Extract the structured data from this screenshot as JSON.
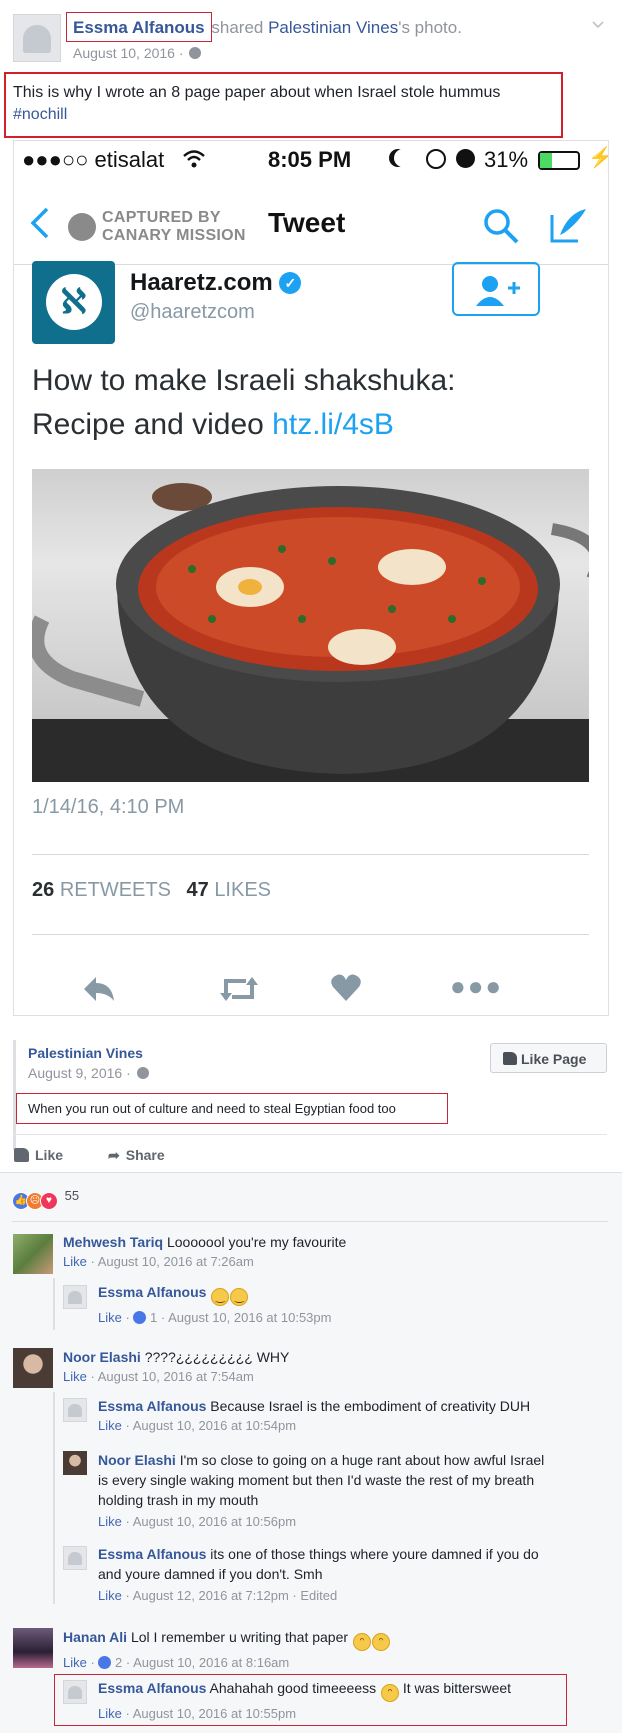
{
  "post": {
    "author": "Essma Alfanous",
    "shared_text": "shared",
    "source_page": "Palestinian Vines",
    "source_suffix": "'s photo.",
    "date": "August 10, 2016 ·",
    "caption_line1": "This is why I wrote an 8 page paper about when Israel stole hummus",
    "hashtag": "#nochill"
  },
  "phone": {
    "status": {
      "carrier": "●●●○○ etisalat",
      "time": "8:05 PM",
      "battery": "31%"
    },
    "nav": {
      "captured_line1": "CAPTURED BY",
      "captured_line2": "CANARY MISSION",
      "title": "Tweet"
    },
    "tweet": {
      "account_name": "Haaretz.com",
      "handle": "@haaretzcom",
      "text_line1": "How to make Israeli shakshuka:",
      "text_line2": "Recipe and video",
      "link": "htz.li/4sB",
      "timestamp": "1/14/16, 4:10 PM",
      "retweets_count": "26",
      "retweets_label": "RETWEETS",
      "likes_count": "47",
      "likes_label": "LIKES"
    }
  },
  "shared_from": {
    "page_name": "Palestinian Vines",
    "date": "August 9, 2016 ·",
    "like_page_label": "Like Page",
    "description": "When you run out of culture and need to steal Egyptian food too"
  },
  "actions": {
    "like": "Like",
    "share": "Share"
  },
  "reactions": {
    "count": "55"
  },
  "comments": [
    {
      "name": "Mehwesh Tariq",
      "text": "Looooool you're my favourite",
      "like": "Like",
      "meta": " · August 10, 2016 at 7:26am"
    },
    {
      "name": "Essma Alfanous",
      "text": "",
      "like": "Like",
      "likes": "1",
      "meta": " · August 10, 2016 at 10:53pm"
    },
    {
      "name": "Noor Elashi",
      "text": "????¿¿¿¿¿¿¿¿¿ WHY",
      "like": "Like",
      "meta": " · August 10, 2016 at 7:54am"
    },
    {
      "name": "Essma Alfanous",
      "text": "Because Israel is the embodiment of creativity DUH",
      "like": "Like",
      "meta": " · August 10, 2016 at 10:54pm"
    },
    {
      "name": "Noor Elashi",
      "text1": "I'm so close to going on a huge rant about how awful Israel",
      "text2": "is every single waking moment but then I'd waste the rest of my breath",
      "text3": "holding trash in my mouth",
      "like": "Like",
      "meta": " · August 10, 2016 at 10:56pm"
    },
    {
      "name": "Essma Alfanous",
      "text1": "its one of those things where youre damned if you do",
      "text2": "and youre damned if you don't. Smh",
      "like": "Like",
      "meta": " · August 12, 2016 at 7:12pm · Edited"
    },
    {
      "name": "Hanan Ali",
      "text": "Lol I remember u writing that paper",
      "like": "Like",
      "likes": "2",
      "meta": " · August 10, 2016 at 8:16am"
    },
    {
      "name": "Essma Alfanous",
      "text": "Ahahahah good timeeeess",
      "text_after": "It was bittersweet",
      "like": "Like",
      "meta": " · August 10, 2016 at 10:55pm"
    }
  ],
  "colors": {
    "fb_link": "#365899",
    "fb_blue": "#4267b2",
    "twitter_blue": "#1da1f2",
    "annotation_red": "#d1202a"
  }
}
